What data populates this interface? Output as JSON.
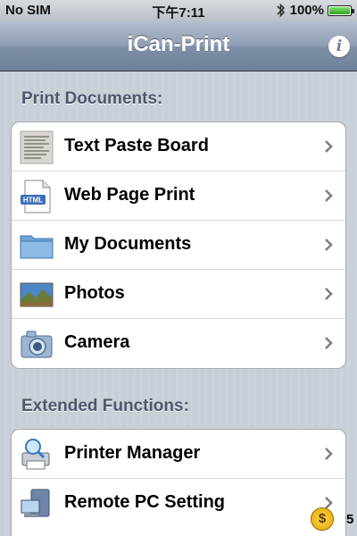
{
  "status_bar": {
    "carrier": "No SIM",
    "time": "下午7:11",
    "battery": "100%",
    "battery_level": 1.0
  },
  "nav": {
    "title": "iCan-Print",
    "info_icon": "i"
  },
  "sections": {
    "print_documents": {
      "header": "Print Documents:",
      "items": [
        {
          "label": "Text Paste Board",
          "icon": "paper-document-icon"
        },
        {
          "label": "Web Page Print",
          "icon": "html-file-icon"
        },
        {
          "label": "My Documents",
          "icon": "folder-icon"
        },
        {
          "label": "Photos",
          "icon": "landscape-photo-icon"
        },
        {
          "label": "Camera",
          "icon": "camera-icon"
        }
      ]
    },
    "extended_functions": {
      "header": "Extended Functions:",
      "items": [
        {
          "label": "Printer Manager",
          "icon": "printer-search-icon"
        },
        {
          "label": "Remote PC Setting",
          "icon": "computer-icon"
        }
      ]
    }
  },
  "overlay": {
    "coin_symbol": "$",
    "coin_count": "5"
  },
  "colors": {
    "nav_bar": "#7e8fa6",
    "section_header": "#4c566c",
    "background": "#c5ccd4"
  }
}
